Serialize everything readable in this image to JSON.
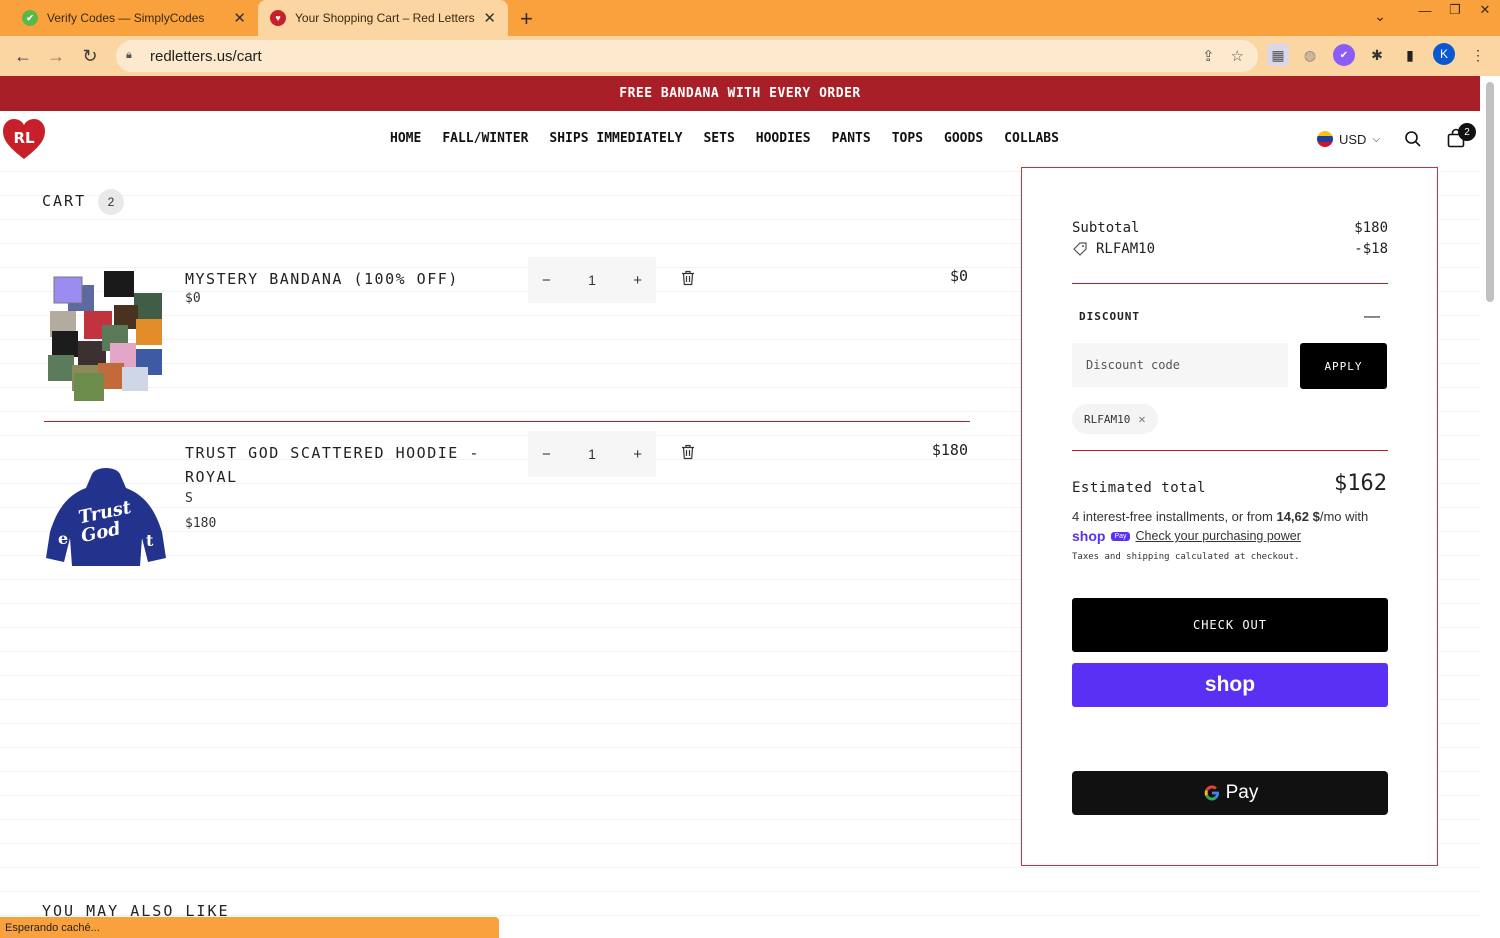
{
  "browser": {
    "tabs": [
      {
        "title": "Verify Codes — SimplyCodes",
        "active": false
      },
      {
        "title": "Your Shopping Cart – Red Letters",
        "active": true
      }
    ],
    "url": "redletters.us/cart",
    "profile_initial": "K",
    "status_text": "Esperando caché..."
  },
  "announcement": "FREE BANDANA WITH EVERY ORDER",
  "nav": [
    "HOME",
    "FALL/WINTER",
    "SHIPS IMMEDIATELY",
    "SETS",
    "HOODIES",
    "PANTS",
    "TOPS",
    "GOODS",
    "COLLABS"
  ],
  "header": {
    "logo_text": "RL",
    "currency": "USD",
    "cart_count": "2"
  },
  "cart": {
    "title": "CART",
    "count": "2",
    "items": [
      {
        "name": "MYSTERY BANDANA (100% OFF)",
        "variant": "",
        "unit_price": "$0",
        "quantity": "1",
        "line_price": "$0"
      },
      {
        "name": "TRUST GOD SCATTERED HOODIE - ROYAL",
        "variant": "S",
        "unit_price": "$180",
        "quantity": "1",
        "line_price": "$180"
      }
    ]
  },
  "summary": {
    "subtotal_label": "Subtotal",
    "subtotal_value": "$180",
    "code_applied": "RLFAM10",
    "code_discount": "-$18",
    "discount_heading": "DISCOUNT",
    "discount_placeholder": "Discount code",
    "apply_label": "APPLY",
    "chip_code": "RLFAM10",
    "estimated_label": "Estimated total",
    "estimated_value": "$162",
    "installments_prefix": "4 interest-free installments, or from ",
    "installments_amount": "14,62 $",
    "installments_suffix": "/mo with",
    "shoppay_logo": "shop",
    "shoppay_badge": "Pay",
    "purchasing_power_link": "Check your purchasing power",
    "taxes_note": "Taxes and shipping calculated at checkout.",
    "checkout_label": "CHECK OUT",
    "shop_button_label": "shop",
    "gpay_label": "Pay"
  },
  "also_like_title": "YOU MAY ALSO LIKE",
  "colors": {
    "brand_red": "#a81f27",
    "tab_orange": "#f9a23d",
    "shop_purple": "#5a31f4"
  }
}
